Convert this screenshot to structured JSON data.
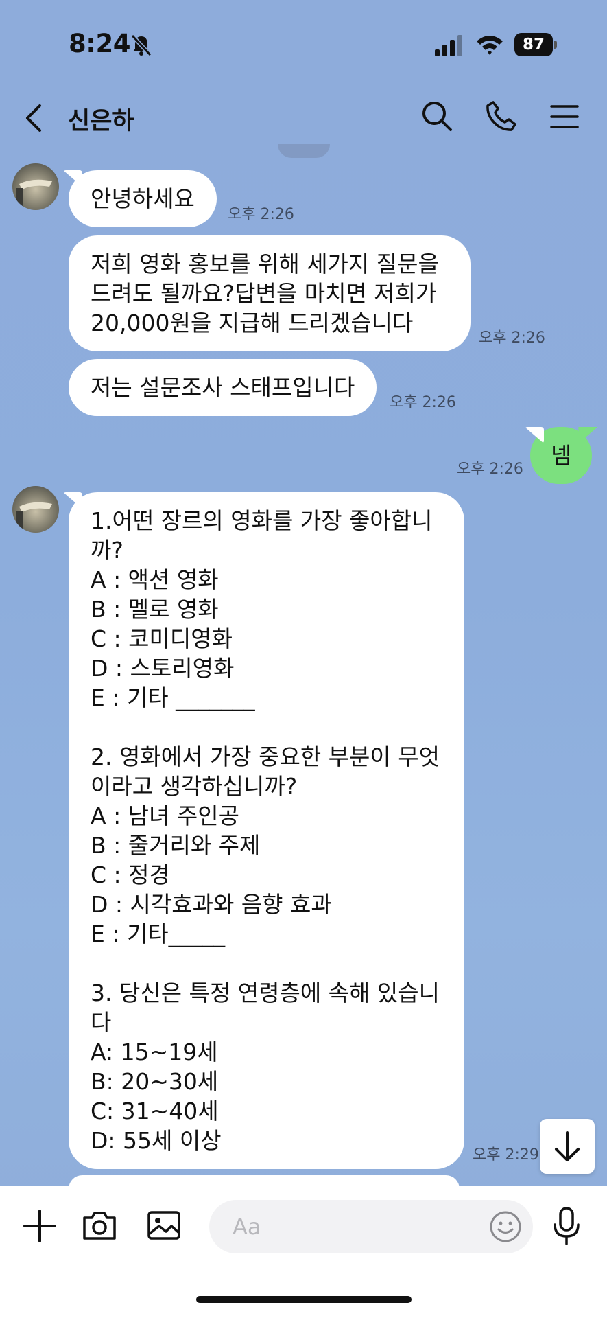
{
  "status_bar": {
    "time": "8:24",
    "battery": "87"
  },
  "header": {
    "title": "신은하"
  },
  "messages": [
    {
      "sender": "other",
      "text": "안녕하세요",
      "time": "오후 2:26"
    },
    {
      "sender": "other",
      "text": "저희 영화 홍보를 위해 세가지 질문을\n드려도 될까요?답변을 마치면 저희가\n20,000원을 지급해 드리겠습니다",
      "time": "오후 2:26"
    },
    {
      "sender": "other",
      "text": "저는 설문조사 스태프입니다",
      "time": "오후 2:26"
    },
    {
      "sender": "me",
      "text": "넴",
      "time": "오후 2:26"
    },
    {
      "sender": "other",
      "text": "1.어떤 장르의 영화를 가장 좋아합니\n까?\nA : 액션 영화\nB : 멜로 영화\nC : 코미디영화\nD : 스토리영화\nE : 기타 _______\n\n2. 영화에서 가장 중요한 부분이 무엇\n이라고 생각하십니까?\nA : 남녀 주인공\nB : 줄거리와 주제\nC : 정경\nD : 시각효과와 음향 효과\nE : 기타_____\n\n3. 당신은 특정 연령층에 속해 있습니\n다\nA: 15~19세\nB: 20~30세\nC: 31~40세\nD: 55세 이상",
      "time": "오후 2:29"
    }
  ],
  "input": {
    "placeholder": "Aa"
  },
  "colors": {
    "chat_background": "#8eacdb",
    "my_bubble": "#7ce07f",
    "other_bubble": "#ffffff"
  },
  "icons": [
    "back-icon",
    "search-icon",
    "call-icon",
    "menu-icon",
    "plus-icon",
    "camera-icon",
    "image-icon",
    "emoji-icon",
    "mic-icon",
    "scroll-down-icon"
  ]
}
